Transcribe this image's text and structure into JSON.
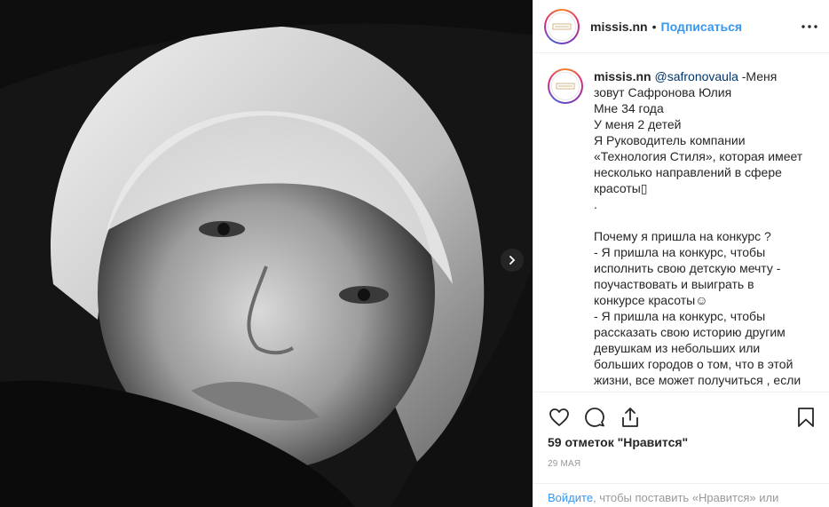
{
  "post": {
    "author": "missis.nn",
    "separator": "•",
    "follow_label": "Подписаться",
    "more_icon": "more-options-icon",
    "avatar_icon": "brand-logo-icon"
  },
  "caption": {
    "username": "missis.nn",
    "mention": "@safronovaula",
    "text": " -Меня зовут Сафронова Юлия\nМне 34 года\nУ меня 2 детей\nЯ Руководитель компании «Технология Стиля», которая имеет несколько направлений в сфере красоты▯\n.\n\nПочему я пришла на конкурс ?\n- Я пришла на конкурс, чтобы исполнить свою детскую мечту - поучаствовать и выиграть в конкурсе красоты☺\n- Я пришла на конкурс, чтобы рассказать свою историю другим девушкам из небольших или больших городов о том, что в этой жизни, все может получиться , если"
  },
  "actions": {
    "like_icon": "heart-icon",
    "comment_icon": "comment-icon",
    "share_icon": "share-icon",
    "save_icon": "bookmark-icon"
  },
  "stats": {
    "likes_text": "59 отметок \"Нравится\"",
    "date": "29 мая"
  },
  "login_prompt": {
    "link": "Войдите",
    "text": ", чтобы поставить «Нравится» или"
  },
  "colors": {
    "link_blue": "#3897f0",
    "text": "#262626",
    "muted": "#999999"
  }
}
